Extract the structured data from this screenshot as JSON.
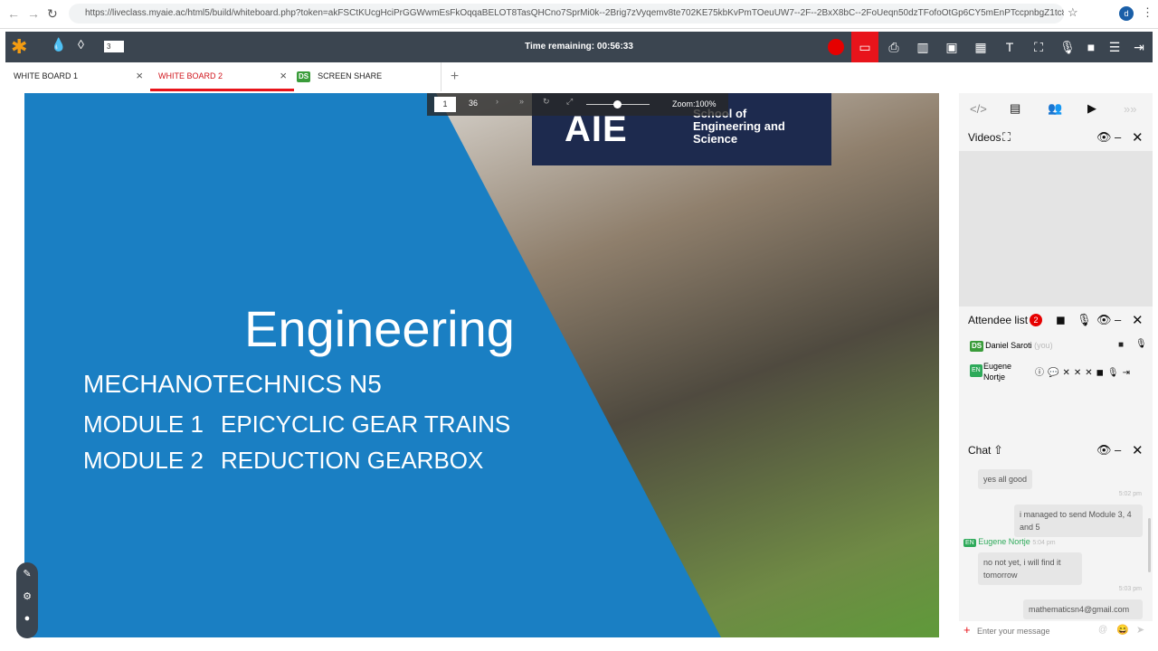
{
  "browser": {
    "url": "https://liveclass.myaie.ac/html5/build/whiteboard.php?token=akFSCtKUcgHciPrGGWwmEsFkOqqaBELOT8TasQHCno7SprMi0k--2Brig7zVyqemv8te702KE75kbKvPmTOeuUW7--2F--2BxX8bC--2FoUeqn50dzTFofoOtGp6CY5mEnPTccpnbgZ1tc8LTIM8aNePFeKC...",
    "profile_initial": "d"
  },
  "appbar": {
    "stroke_width": "3",
    "timer": "Time remaining: 00:56:33",
    "record_color": "#e60000",
    "active_color": "#e8141b"
  },
  "tabs": [
    {
      "label": "WHITE BOARD 1"
    },
    {
      "label": "WHITE BOARD 2",
      "active": true
    },
    {
      "label": "SCREEN SHARE",
      "badge": "DS"
    }
  ],
  "pager": {
    "current": "1",
    "total": "36",
    "zoom": "Zoom:100%",
    "zoom_fraction": 0.3
  },
  "slide": {
    "logo": "AIE",
    "logo_sub": [
      "School of",
      "Engineering and",
      "Science"
    ],
    "title": "Engineering",
    "subtitle": "MECHANOTECHNICS N5",
    "modules": [
      {
        "num": "MODULE 1",
        "name": "EPICYCLIC GEAR TRAINS"
      },
      {
        "num": "MODULE 2",
        "name": "REDUCTION GEARBOX"
      }
    ]
  },
  "side": {
    "videos_title": "Videos",
    "attendee_title": "Attendee list",
    "attendee_count": "2",
    "attendees": [
      {
        "initials": "DS",
        "name": "Daniel Saroti",
        "you": "(you)"
      },
      {
        "initials": "EN",
        "name": "Eugene Nortje"
      }
    ],
    "chat_title": "Chat",
    "messages": [
      {
        "text": "yes all good",
        "mine": false
      },
      {
        "time": "5:02 pm",
        "text": "i managed to send Module 3, 4 and 5",
        "mine": true
      },
      {
        "sender_initials": "EN",
        "sender": "Eugene Nortje",
        "time": "5:04 pm",
        "text": "no not yet, i will find it tomorrow",
        "mine": false
      },
      {
        "time": "5:03 pm",
        "text": "mathematicsn4@gmail.com",
        "mine": true
      }
    ],
    "input_placeholder": "Enter your message"
  }
}
